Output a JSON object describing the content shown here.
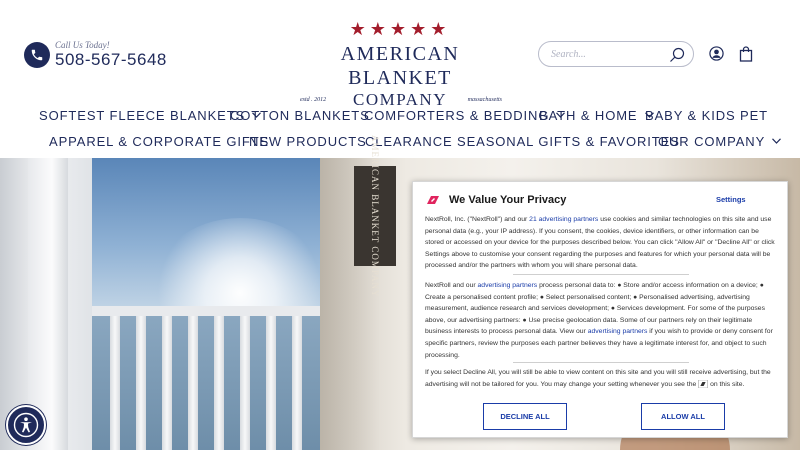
{
  "header": {
    "call_us": "Call Us Today!",
    "phone": "508-567-5648",
    "logo": {
      "stars": "★★★★★",
      "line1": "AMERICAN BLANKET",
      "company": "COMPANY",
      "estd": "estd . 2012",
      "state": "massachusetts"
    },
    "search_placeholder": "Search...",
    "icons": [
      "phone-icon",
      "search-icon",
      "account-icon",
      "cart-icon"
    ]
  },
  "nav": {
    "row1": [
      {
        "label": "SOFTEST FLEECE BLANKETS",
        "dropdown": true
      },
      {
        "label": "COTTON BLANKETS",
        "dropdown": false
      },
      {
        "label": "COMFORTERS & BEDDING",
        "dropdown": true
      },
      {
        "label": "BATH & HOME",
        "dropdown": true
      },
      {
        "label": "BABY & KIDS",
        "dropdown": false
      },
      {
        "label": "PET",
        "dropdown": false
      }
    ],
    "row2": [
      {
        "label": "APPAREL & CORPORATE GIFTS",
        "dropdown": false
      },
      {
        "label": "NEW PRODUCTS",
        "dropdown": false
      },
      {
        "label": "CLEARANCE",
        "dropdown": false
      },
      {
        "label": "SEASONAL GIFTS & FAVORITES",
        "dropdown": false
      },
      {
        "label": "OUR COMPANY",
        "dropdown": true
      }
    ]
  },
  "hero": {
    "tag_text": "AMERICAN BLANKET COMPANY"
  },
  "consent": {
    "title": "We Value Your Privacy",
    "settings": "Settings",
    "p1_a": "NextRoll, Inc. (\"NextRoll\") and our ",
    "p1_link": "21 advertising partners",
    "p1_b": " use cookies and similar technologies on this site and use personal data (e.g., your IP address). If you consent, the cookies, device identifiers, or other information can be stored or accessed on your device for the purposes described below. You can click \"Allow All\" or \"Decline All\" or click Settings above to customise your consent regarding the purposes and features for which your personal data will be processed and/or the partners with whom you will share personal data.",
    "p2_a": "NextRoll and our ",
    "p2_link": "advertising partners",
    "p2_b": " process personal data to: ● Store and/or access information on a device; ● Create a personalised content profile; ● Select personalised content; ● Personalised advertising, advertising measurement, audience research and services development; ● Services development. For some of the purposes above, our advertising partners: ● Use precise geolocation data. Some of our partners rely on their legitimate business interests to process personal data. View our ",
    "p2_link2": "advertising partners",
    "p2_c": " if you wish to provide or deny consent for specific partners, review the purposes each partner believes they have a legitimate interest for, and object to such processing.",
    "p3_a": "If you select Decline All, you will still be able to view content on this site and you will still receive advertising, but the advertising will not be tailored for you. You may change your setting whenever you see the ",
    "p3_b": " on this site.",
    "decline": "DECLINE ALL",
    "allow": "ALLOW ALL",
    "accent": "#1a3ca8",
    "brand_icon_color": "#e0245e"
  },
  "accessibility": {
    "icon": "accessibility-icon"
  },
  "colors": {
    "navy": "#1f2a5a",
    "star_red": "#a31d2c"
  }
}
